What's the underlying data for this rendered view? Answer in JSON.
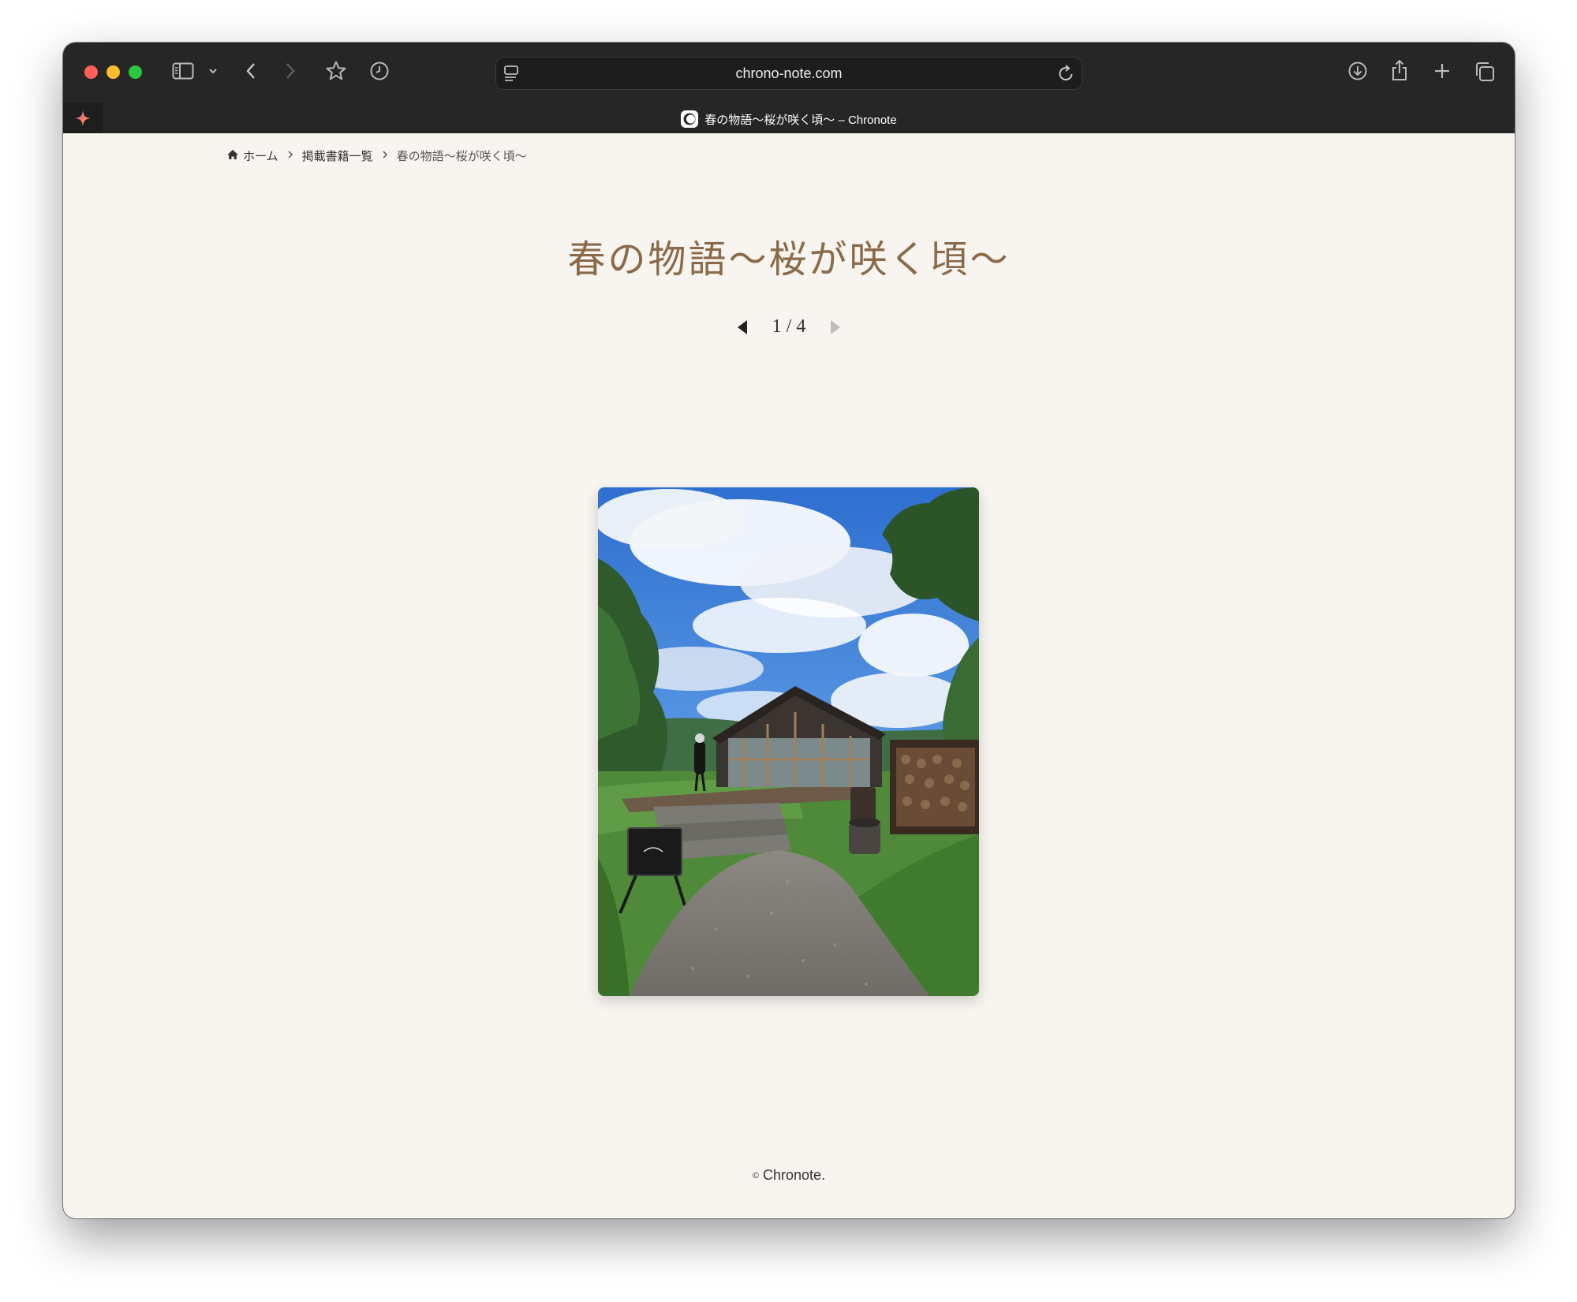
{
  "browser": {
    "url": "chrono-note.com",
    "tab_title": "春の物語〜桜が咲く頃〜 – Chronote"
  },
  "breadcrumb": {
    "home": "ホーム",
    "books": "掲載書籍一覧",
    "current": "春の物語〜桜が咲く頃〜"
  },
  "page": {
    "title": "春の物語〜桜が咲く頃〜",
    "pager": {
      "text": "1 / 4",
      "current": 1,
      "total": 4
    }
  },
  "footer": {
    "copyright_symbol": "©",
    "text": "Chronote."
  },
  "colors": {
    "page_bg": "#f8f5f0",
    "title": "#8a6a48",
    "chrome": "#262626"
  },
  "icons": [
    "sidebar-icon",
    "chevron-down-icon",
    "back-icon",
    "forward-icon",
    "star-icon",
    "history-icon",
    "reader-icon",
    "reload-icon",
    "download-icon",
    "share-icon",
    "new-tab-icon",
    "tabs-overview-icon",
    "home-icon",
    "prev-arrow-icon",
    "next-arrow-icon"
  ]
}
